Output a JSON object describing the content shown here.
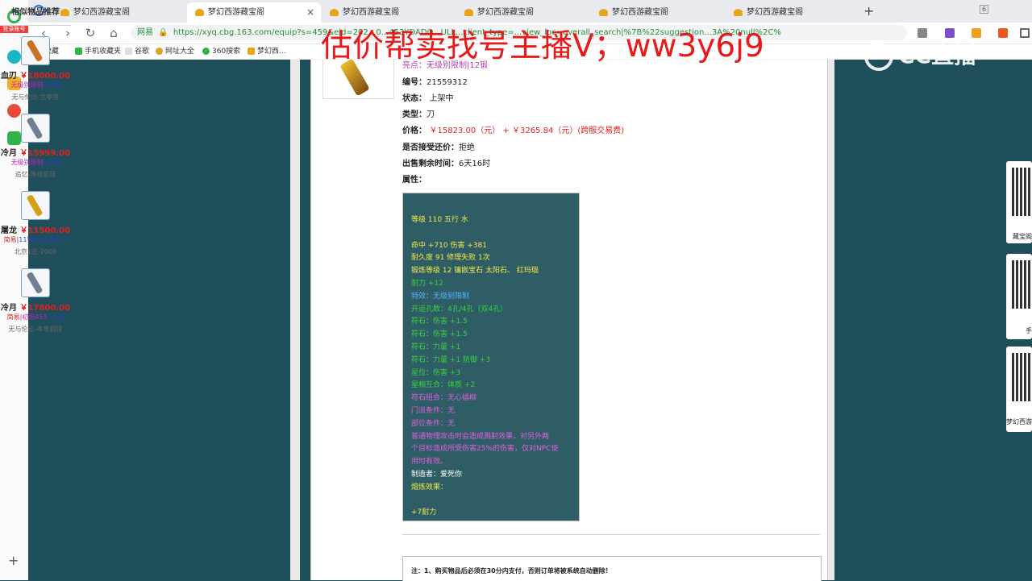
{
  "browser": {
    "leftbar_label": "登录账号",
    "tabs": [
      {
        "title": "梦幻西游藏宝阁"
      },
      {
        "title": "梦幻西游藏宝阁"
      },
      {
        "title": "梦幻西游藏宝阁"
      },
      {
        "title": "梦幻西游藏宝阁"
      },
      {
        "title": "梦幻西游藏宝阁"
      },
      {
        "title": "梦幻西游藏宝阁"
      }
    ],
    "tab_count_badge": "6",
    "new_tab_symbol": "+",
    "url": "https://xyq.cbg.163.com/equip?s=459&eid=202...0...453YDADO...ULL...client_type=...view_loc=overall_search|%7B%22suggestion...3A%20null%2C%",
    "site_badge": "网易",
    "bookmarks": [
      "收藏",
      "手机收藏夹",
      "谷歌",
      "网址大全",
      "360搜索",
      "梦幻西..."
    ]
  },
  "overlay": {
    "text": "估价帮卖找号主播V；ww3y6j9",
    "logo": "CC直播"
  },
  "item": {
    "partial_row": "亮点：无级别限制|12锻",
    "fields": [
      {
        "label": "编号",
        "value": "21559312"
      },
      {
        "label": "状态",
        "value": "上架中"
      },
      {
        "label": "类型",
        "value": "刀"
      }
    ],
    "price_label": "价格",
    "price_main": "￥15823.00（元）",
    "price_plus": "+",
    "price_extra": "￥3265.84（元）(跨服交易费)",
    "counter_label": "是否接受还价",
    "counter_value": "拒绝",
    "remaining_label": "出售剩余时间",
    "remaining_value": "6天16时",
    "attr_label": "属性",
    "attributes": [
      {
        "text": "等级 110 五行 水",
        "color": "#f2e94a"
      },
      {
        "text": "",
        "color": "#f2e94a"
      },
      {
        "text": "命中 +710 伤害 +381",
        "color": "#f2e94a"
      },
      {
        "text": "耐久度 91 修理失败 1次",
        "color": "#f2e94a"
      },
      {
        "text": "锻炼等级 12 镶嵌宝石 太阳石、 红玛瑙",
        "color": "#f2e94a"
      },
      {
        "text": "耐力 +12",
        "color": "#3ad13a"
      },
      {
        "text": "特效：无级别限制",
        "color": "#5ab0ff"
      },
      {
        "text": "开运孔数：4孔/4孔（双4孔）",
        "color": "#3ad13a"
      },
      {
        "text": "符石：伤害 +1.5",
        "color": "#3ad13a"
      },
      {
        "text": "符石：伤害 +1.5",
        "color": "#3ad13a"
      },
      {
        "text": "符石：力量 +1",
        "color": "#3ad13a"
      },
      {
        "text": "符石：力量 +1 防御 +3",
        "color": "#3ad13a"
      },
      {
        "text": "星位：伤害 +3",
        "color": "#3ad13a"
      },
      {
        "text": "星相互合：体质 +2",
        "color": "#3ad13a"
      },
      {
        "text": "符石组合：无心插柳",
        "color": "#e060e0"
      },
      {
        "text": "门派条件：无",
        "color": "#e060e0"
      },
      {
        "text": "部位条件：无",
        "color": "#e060e0"
      },
      {
        "text": "普通物理攻击时会造成溅射效果，对另外两",
        "color": "#e060e0"
      },
      {
        "text": "个目标造成所受伤害25%的伤害，仅对NPC使",
        "color": "#e060e0"
      },
      {
        "text": "用时有效。",
        "color": "#e060e0"
      },
      {
        "text": "制造者：爱死你",
        "color": "#ffffff"
      },
      {
        "text": "熔炼效果：",
        "color": "#f2e94a"
      },
      {
        "text": "",
        "color": "#f2e94a"
      },
      {
        "text": "+7耐力",
        "color": "#f2e94a"
      }
    ],
    "note": "注：1、购买物品后必须在30分内支付，否则订单将被系统自动删除！"
  },
  "similar": {
    "title": "相似物品推荐",
    "items": [
      {
        "name": "血刃",
        "price": "￥18000.00",
        "tags": [
          {
            "t": "无级别限制",
            "c": "#c020c0"
          },
          {
            "t": "|12锻",
            "c": "#2a3fbf"
          }
        ],
        "server": "无与伦比-兰亭序",
        "icon_color": "#c9732a"
      },
      {
        "name": "冷月",
        "price": "￥15999.00",
        "tags": [
          {
            "t": "无级别限制",
            "c": "#c020c0"
          },
          {
            "t": "|12锻",
            "c": "#2a3fbf"
          }
        ],
        "server": "追忆-再续前缘",
        "icon_color": "#6f7f8f"
      },
      {
        "name": "屠龙",
        "price": "￥11500.00",
        "tags": [
          {
            "t": "简易",
            "c": "#e02020"
          },
          {
            "t": "|11锻",
            "c": "#2a3fbf"
          },
          {
            "t": "|初总伤611",
            "c": "#2a3fbf"
          }
        ],
        "server": "北京1区-2008",
        "icon_color": "#d4a017"
      },
      {
        "name": "冷月",
        "price": "￥17800.00",
        "tags": [
          {
            "t": "简易",
            "c": "#e02020"
          },
          {
            "t": "|初伤451",
            "c": "#c020c0"
          },
          {
            "t": "|11锻",
            "c": "#2a3fbf"
          }
        ],
        "server": "无与伦比-本草纲目",
        "icon_color": "#6f7f8f"
      }
    ]
  },
  "qr_cards": [
    "藏宝阁",
    "手",
    "梦幻西游"
  ]
}
